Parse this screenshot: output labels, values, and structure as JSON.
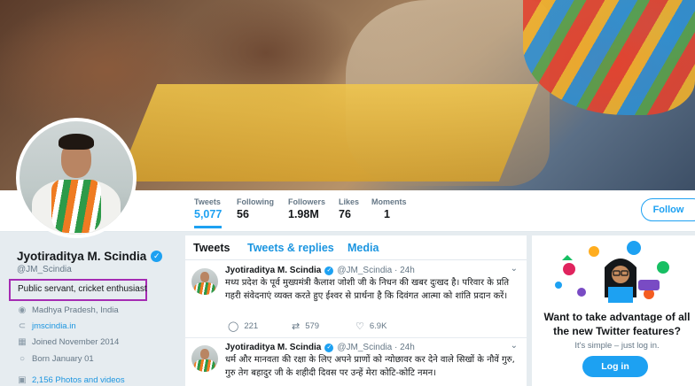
{
  "profile": {
    "name": "Jyotiraditya M. Scindia",
    "handle": "@JM_Scindia",
    "bio": "Public servant, cricket enthusiast",
    "location": "Madhya Pradesh, India",
    "website": "jmscindia.in",
    "joined": "Joined November 2014",
    "born": "Born January 01",
    "photos": "2,156 Photos and videos"
  },
  "stats": [
    {
      "label": "Tweets",
      "value": "5,077"
    },
    {
      "label": "Following",
      "value": "56"
    },
    {
      "label": "Followers",
      "value": "1.98M"
    },
    {
      "label": "Likes",
      "value": "76"
    },
    {
      "label": "Moments",
      "value": "1"
    }
  ],
  "follow_label": "Follow",
  "tabs": [
    "Tweets",
    "Tweets & replies",
    "Media"
  ],
  "tweets": [
    {
      "name": "Jyotiraditya M. Scindia",
      "handle": "@JM_Scindia · 24h",
      "text": "मध्य प्रदेश के पूर्व मुख्यमंत्री कैलाश जोशी जी के निधन की खबर दुःखद है। परिवार के प्रति गहरी संवेदनाएं व्यक्त करते हुए ईश्वर से प्रार्थना है कि दिवंगत आत्मा को शांति प्रदान करें।",
      "replies": "221",
      "retweets": "579",
      "likes": "6.9K"
    },
    {
      "name": "Jyotiraditya M. Scindia",
      "handle": "@JM_Scindia · 24h",
      "text": "धर्म और मानवता की रक्षा के लिए अपने प्राणों को न्योछावर कर देने वाले सिखों के नौवें गुरु, गुरु तेग बहादुर जी के शहीदी दिवस पर उन्हें मेरा कोटि-कोटि नमन।"
    }
  ],
  "promo": {
    "title": "Want to take advantage of all the new Twitter features?",
    "subtitle": "It's simple – just log in.",
    "login_label": "Log in"
  },
  "colors": {
    "accent": "#1da1f2",
    "bio_highlight": "#a52bb3"
  },
  "icons": {
    "verified": "verified-badge-icon",
    "location": "location-pin-icon",
    "link": "link-icon",
    "calendar": "calendar-icon",
    "balloon": "balloon-icon",
    "photos": "photo-icon",
    "reply": "reply-icon",
    "retweet": "retweet-icon",
    "like": "heart-icon",
    "caret": "chevron-down-icon"
  }
}
